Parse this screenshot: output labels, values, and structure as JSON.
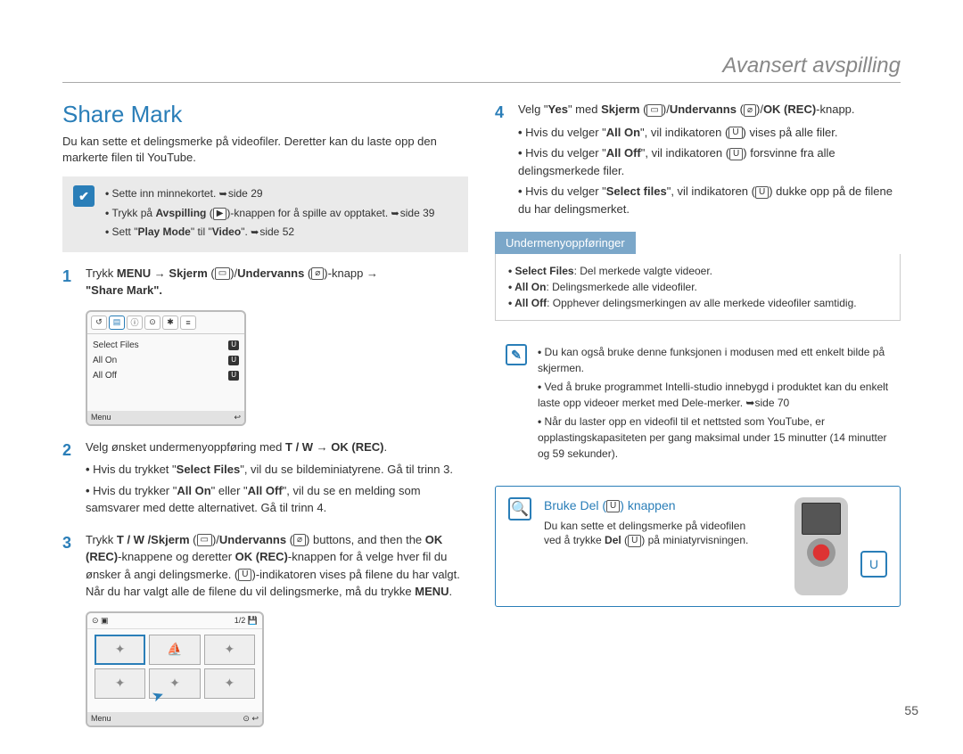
{
  "header": {
    "title": "Avansert avspilling"
  },
  "section": {
    "title": "Share Mark",
    "intro": "Du kan sette et delingsmerke på videofiler. Deretter kan du laste opp den markerte filen til YouTube."
  },
  "prereq": {
    "items": [
      {
        "text": "Sette inn minnekortet.",
        "ref": "side 29"
      },
      {
        "pre": "Trykk på ",
        "bold": "Avspilling",
        "icon": "▶",
        "post": "-knappen for å spille av opptaket.",
        "ref": "side 39"
      },
      {
        "pre": "Sett \"",
        "bold": "Play Mode",
        "mid": "\" til \"",
        "bold2": "Video",
        "post": "\".",
        "ref": "side 52"
      }
    ]
  },
  "step1": {
    "pre": "Trykk ",
    "menu": "MENU",
    "arrow": " → ",
    "skjerm": "Skjerm",
    "screen_icon": "▭",
    "slash": "/",
    "under": "Undervanns",
    "under_icon": "⌀",
    "post": "-knapp → ",
    "quote": "\"Share Mark\"."
  },
  "menu_mock": {
    "tabs": [
      "↺",
      "▤",
      "ⓘ",
      "⊙",
      "✱",
      "≡"
    ],
    "items": [
      {
        "label": "Select Files",
        "badge": "U"
      },
      {
        "label": "All On",
        "badge": "U"
      },
      {
        "label": "All Off",
        "badge": "U"
      }
    ],
    "footer_left": "Menu",
    "footer_right": "↩"
  },
  "step2": {
    "text": "Velg ønsket undermenyoppføring med ",
    "keys": "T / W",
    "arrow": " → ",
    "ok": "OK (REC)",
    "bullets": [
      {
        "pre": "Hvis du trykket \"",
        "bold": "Select Files",
        "post": "\", vil du se bildeminiatyrene. Gå til trinn 3."
      },
      {
        "pre": "Hvis du trykker \"",
        "bold": "All On",
        "mid": "\" eller \"",
        "bold2": "All Off",
        "post": "\", vil du se en melding som samsvarer med dette alternativet. Gå til trinn 4."
      }
    ]
  },
  "step3": {
    "pre": "Trykk ",
    "keys": "T / W /Skjerm",
    "screen_icon": "▭",
    "slash": "/",
    "under": "Undervanns",
    "under_icon": "⌀",
    "post1": " buttons, and then the ",
    "ok1": "OK (REC)",
    "post2": "-knappene og deretter ",
    "ok2": "OK (REC)",
    "post3": "-knappen for å velge hver fil du ønsker å angi delingsmerke. (",
    "ind_icon": "U",
    "post4": ")-indikatoren vises på filene du har valgt. Når du har valgt alle de filene du vil delingsmerke, må du trykke ",
    "menu": "MENU",
    "period": "."
  },
  "thumb_mock": {
    "top_left": "⊙ ▣",
    "top_right": "1/2 💾",
    "footer_left": "Menu",
    "footer_right": "⊙ ↩"
  },
  "step4": {
    "pre": "Velg \"",
    "yes": "Yes",
    "mid": "\" med ",
    "skjerm": "Skjerm",
    "screen_icon": "▭",
    "slash": "/",
    "under": "Undervanns",
    "under_icon": "⌀",
    "slash2": "/",
    "ok": "OK (REC)",
    "post": "-knapp.",
    "bullets": [
      {
        "pre": "Hvis du velger \"",
        "bold": "All On",
        "mid": "\", vil indikatoren (",
        "icon": "U",
        "post": ") vises på alle filer."
      },
      {
        "pre": "Hvis du velger \"",
        "bold": "All Off",
        "mid": "\", vil indikatoren (",
        "icon": "U",
        "post": ") forsvinne fra alle delingsmerkede filer."
      },
      {
        "pre": "Hvis du velger \"",
        "bold": "Select files",
        "mid": "\", vil indikatoren (",
        "icon": "U",
        "post": ") dukke opp på de filene du har delingsmerket."
      }
    ]
  },
  "submenu_box": {
    "label": "Undermenyoppføringer",
    "items": [
      {
        "bold": "Select Files",
        "text": ": Del merkede valgte videoer."
      },
      {
        "bold": "All On",
        "text": ": Delingsmerkede alle videofiler."
      },
      {
        "bold": "All Off",
        "text": ": Opphever delingsmerkingen av alle merkede videofiler samtidig."
      }
    ]
  },
  "info_box": {
    "items": [
      "Du kan også bruke denne funksjonen i modusen med ett enkelt bilde på skjermen.",
      "Ved å bruke programmet Intelli-studio innebygd i produktet kan du enkelt laste opp videoer merket med Dele-merker. ➥side 70",
      "Når du laster opp en videofil til et nettsted som YouTube, er opplastingskapasiteten per gang maksimal under 15 minutter (14 minutter og 59 sekunder)."
    ]
  },
  "tip_box": {
    "title_pre": "Bruke Del (",
    "title_icon": "U",
    "title_post": ") knappen",
    "line1": "Du kan sette et delingsmerke på videofilen",
    "line2_pre": "ved å trykke ",
    "line2_bold": "Del",
    "line2_icon": "U",
    "line2_post": " på miniatyrvisningen."
  },
  "page_num": "55"
}
